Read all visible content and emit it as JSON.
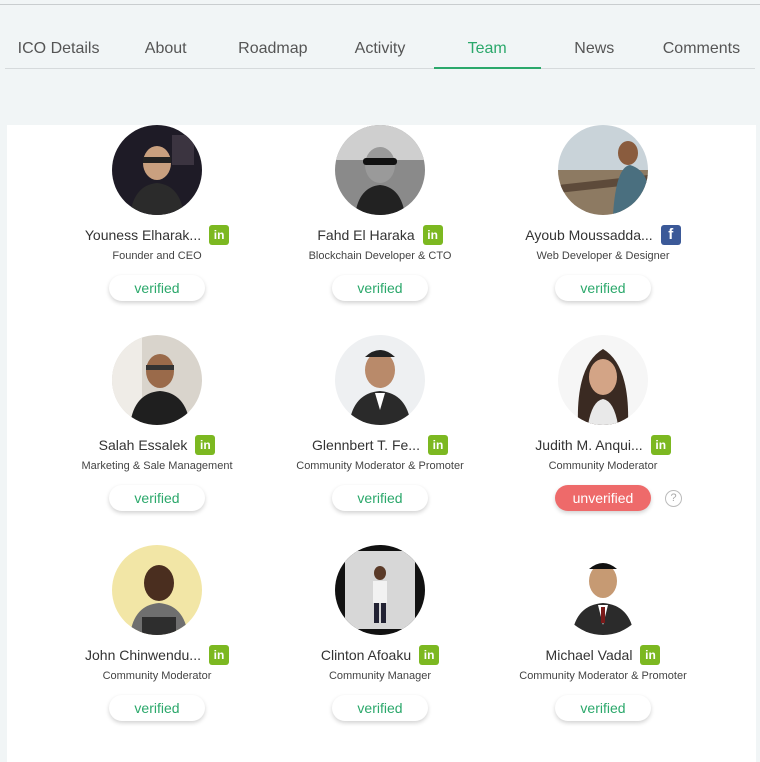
{
  "tabs": [
    "ICO Details",
    "About",
    "Roadmap",
    "Activity",
    "Team",
    "News",
    "Comments"
  ],
  "active_tab": "Team",
  "colors": {
    "accent": "#2ba86b",
    "linkedin": "#7cb821",
    "facebook": "#3b5998",
    "unverified": "#ee6a6a"
  },
  "team": [
    {
      "name": "Youness Elharak...",
      "role": "Founder and CEO",
      "social": "linkedin-icon",
      "status": "verified"
    },
    {
      "name": "Fahd El Haraka",
      "role": "Blockchain Developer & CTO",
      "social": "linkedin-icon",
      "status": "verified"
    },
    {
      "name": "Ayoub Moussadda...",
      "role": "Web Developer & Designer",
      "social": "facebook-icon",
      "status": "verified"
    },
    {
      "name": "Salah Essalek",
      "role": "Marketing & Sale Management",
      "social": "linkedin-icon",
      "status": "verified"
    },
    {
      "name": "Glennbert T. Fe...",
      "role": "Community Moderator & Promoter",
      "social": "linkedin-icon",
      "status": "verified"
    },
    {
      "name": "Judith M. Anqui...",
      "role": "Community Moderator",
      "social": "linkedin-icon",
      "status": "unverified",
      "help": "?"
    },
    {
      "name": "John Chinwendu...",
      "role": "Community Moderator",
      "social": "linkedin-icon",
      "status": "verified"
    },
    {
      "name": "Clinton Afoaku",
      "role": "Community Manager",
      "social": "linkedin-icon",
      "status": "verified"
    },
    {
      "name": "Michael Vadal",
      "role": "Community Moderator & Promoter",
      "social": "linkedin-icon",
      "status": "verified"
    }
  ]
}
